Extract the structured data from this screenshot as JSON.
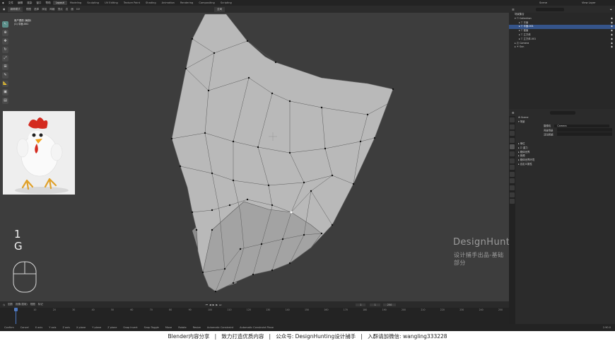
{
  "topbar": {
    "menus": [
      "文件",
      "编辑",
      "渲染",
      "窗口",
      "帮助"
    ],
    "workspaces": [
      "Layout",
      "Modeling",
      "Sculpting",
      "UV Editing",
      "Texture Paint",
      "Shading",
      "Animation",
      "Rendering",
      "Compositing",
      "Scripting"
    ],
    "active_workspace": "Layout",
    "scene": "Scene",
    "view_layer": "View Layer"
  },
  "viewport": {
    "header": {
      "mode": "编辑模式",
      "menus": [
        "视图",
        "选择",
        "添加",
        "网格",
        "顶点",
        "边",
        "面",
        "UV"
      ],
      "transform": "全局"
    },
    "info": {
      "line1": "用户透视 (局部)",
      "line2": "(1) 平面.001"
    },
    "keys_pressed": [
      "1",
      "G"
    ],
    "watermark": {
      "title": "DesignHunting",
      "subtitle": "设计捕手出品-基础部分"
    }
  },
  "outliner": {
    "title": "场景集合",
    "rows": [
      {
        "label": "Collection",
        "indent": 0,
        "selected": false
      },
      {
        "label": "平面",
        "indent": 1,
        "selected": false
      },
      {
        "label": "平面.001",
        "indent": 1,
        "selected": true
      },
      {
        "label": "锥面",
        "indent": 1,
        "selected": false
      },
      {
        "label": "立方体",
        "indent": 1,
        "selected": false
      },
      {
        "label": "立方体.001",
        "indent": 1,
        "selected": false
      },
      {
        "label": "Camera",
        "indent": 0,
        "selected": false
      },
      {
        "label": "Sun",
        "indent": 0,
        "selected": false
      }
    ]
  },
  "properties": {
    "context": "Scene",
    "sections": [
      {
        "label": "场景"
      },
      {
        "label": "摄像机",
        "value": "Camera"
      },
      {
        "label": "背景场景",
        "value": ""
      },
      {
        "label": "活动剪辑",
        "value": ""
      },
      {
        "label": "单位"
      },
      {
        "label": "重力"
      },
      {
        "label": "刚体世界"
      },
      {
        "label": "音频"
      },
      {
        "label": "刚体世界环境"
      },
      {
        "label": "自定义属性"
      }
    ]
  },
  "timeline": {
    "menus": [
      "回放",
      "抠像(插帧)",
      "视图",
      "标记"
    ],
    "current_frame": "1",
    "start": "1",
    "end": "250",
    "ticks": [
      "0",
      "10",
      "20",
      "30",
      "40",
      "50",
      "60",
      "70",
      "80",
      "90",
      "100",
      "110",
      "120",
      "130",
      "140",
      "150",
      "160",
      "170",
      "180",
      "190",
      "200",
      "210",
      "220",
      "230",
      "240",
      "250"
    ]
  },
  "statusbar": {
    "items": [
      "Confirm",
      "Cancel",
      "X axis",
      "Y axis",
      "Z axis",
      "X plane",
      "Y plane",
      "Z plane",
      "Snap Invert",
      "Snap Toggle",
      "Move",
      "Rotate",
      "Resize",
      "Automatic Constraint",
      "Automatic Constraint Plane"
    ],
    "version": "2.90.0"
  },
  "banner": {
    "parts": [
      "Blender内容分享",
      "致力打造优质内容",
      "公众号: DesignHunting设计捕手",
      "入群请加微信: wangling333228"
    ]
  },
  "colors": {
    "viewport_bg": "#3d3d3d",
    "mesh_face": "#b9b9b9",
    "mesh_dark": "#8a8a8a",
    "mesh_edge": "#444444",
    "selection_blue": "#35548a",
    "active_tool": "#5b8f8a"
  }
}
